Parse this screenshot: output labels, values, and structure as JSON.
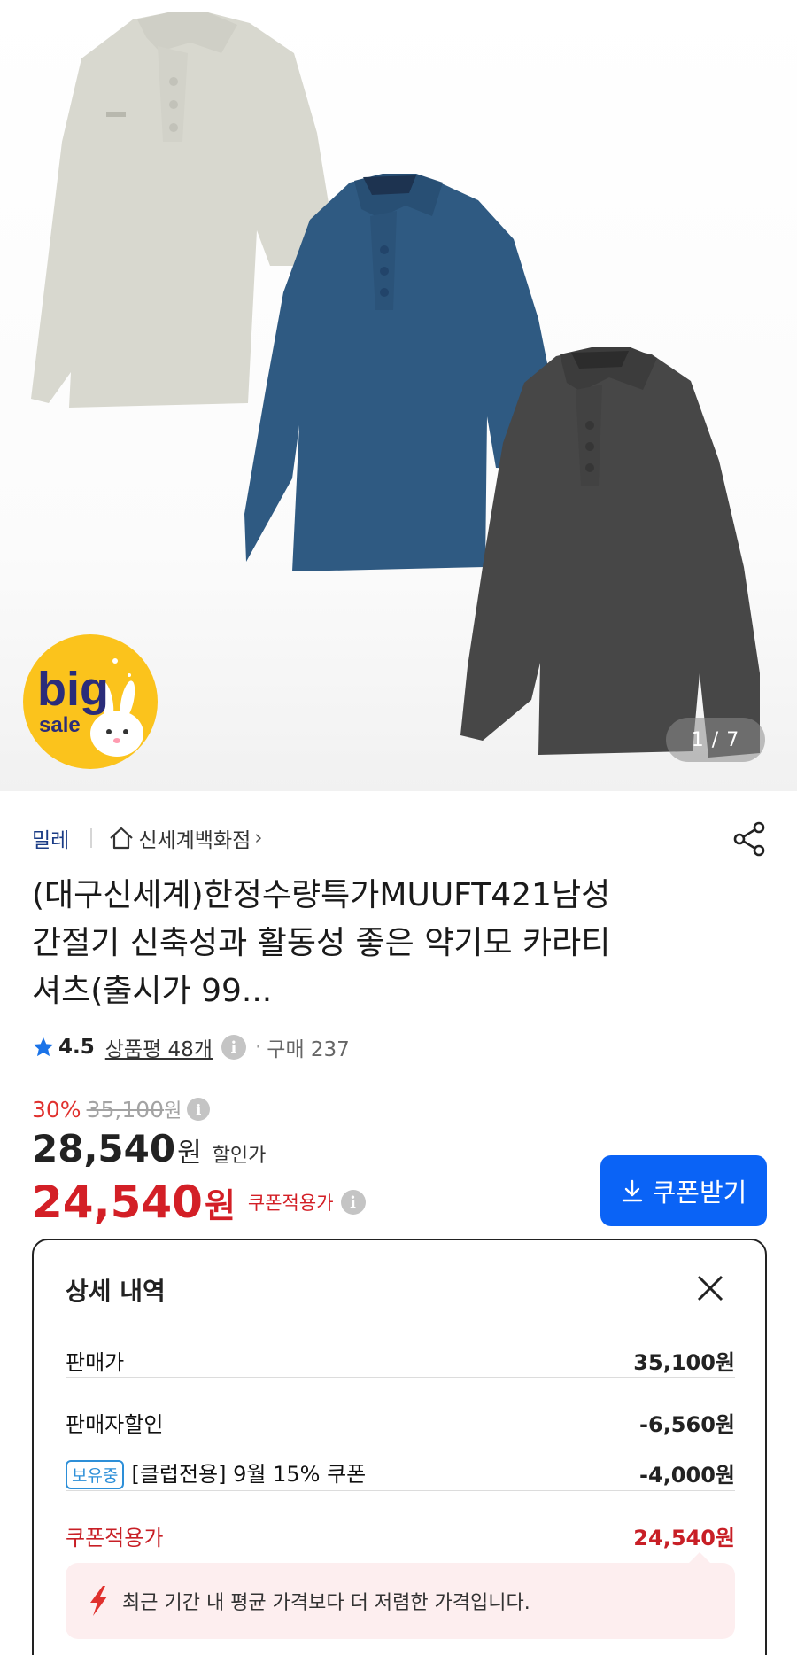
{
  "gallery": {
    "counter": "1 / 7",
    "badge_big": "big",
    "badge_sale": "sale",
    "shirt_colors": [
      "#dcdcd4",
      "#2f5a82",
      "#4a4a4a"
    ]
  },
  "brand": {
    "name": "밀레",
    "store": "신세계백화점",
    "store_chevron": "›"
  },
  "product": {
    "title_line1": "(대구신세계)한정수량특가MUUFT421남성",
    "title_line2": "간절기 신축성과 활동성 좋은 약기모 카라티",
    "title_line3": "셔츠(출시가 99..."
  },
  "rating": {
    "score": "4.5",
    "reviews": "상품평 48개",
    "separator": "·",
    "purchase": "구매 237"
  },
  "price": {
    "discount_rate": "30%",
    "original": "35,100",
    "original_won": "원",
    "sale": "28,540",
    "sale_won": "원",
    "sale_label": "할인가",
    "coupon": "24,540",
    "coupon_won": "원",
    "coupon_label": "쿠폰적용가",
    "coupon_button": "쿠폰받기"
  },
  "detail": {
    "title": "상세 내역",
    "rows": [
      {
        "label": "판매가",
        "value": "35,100원"
      },
      {
        "label": "판매자할인",
        "value": "-6,560원"
      },
      {
        "badge": "보유중",
        "label": "[클럽전용] 9월 15% 쿠폰",
        "value": "-4,000원"
      },
      {
        "label": "쿠폰적용가",
        "value": "24,540원"
      }
    ],
    "tip": "최근 기간 내 평균 가격보다 더 저렴한 가격입니다."
  },
  "colors": {
    "accent_blue": "#0a63f6",
    "price_red": "#d31f26",
    "brand_navy": "#1b3c86"
  }
}
